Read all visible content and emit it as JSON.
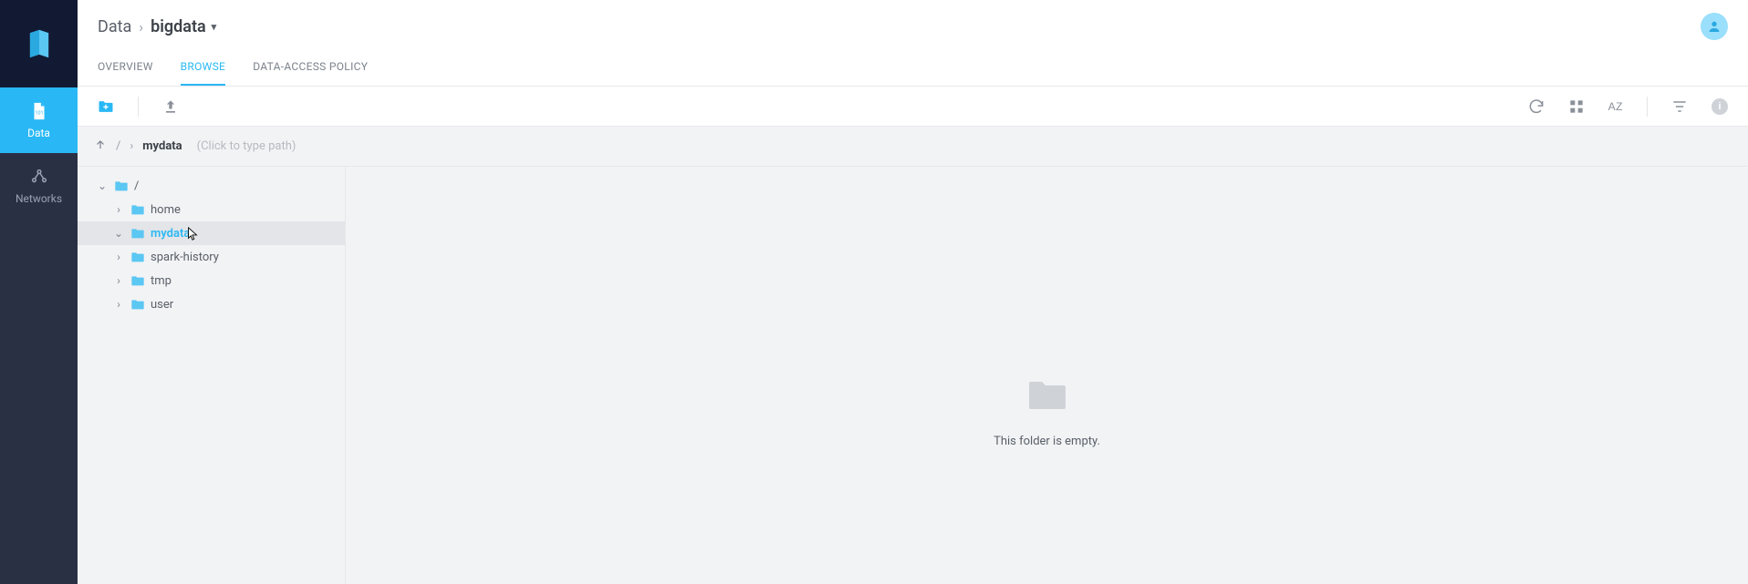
{
  "rail": {
    "items": [
      {
        "label": "Data",
        "active": true
      },
      {
        "label": "Networks",
        "active": false
      }
    ]
  },
  "breadcrumb": {
    "root": "Data",
    "current": "bigdata"
  },
  "tabs": [
    {
      "label": "OVERVIEW",
      "active": false
    },
    {
      "label": "BROWSE",
      "active": true
    },
    {
      "label": "DATA-ACCESS POLICY",
      "active": false
    }
  ],
  "toolbar": {
    "sort_label": "AZ",
    "info_glyph": "i"
  },
  "pathbar": {
    "slash1": "/",
    "chevron": "›",
    "current": "mydata",
    "placeholder": "(Click to type path)"
  },
  "tree": {
    "root_label": "/",
    "items": [
      {
        "label": "home",
        "selected": false
      },
      {
        "label": "mydata",
        "selected": true
      },
      {
        "label": "spark-history",
        "selected": false
      },
      {
        "label": "tmp",
        "selected": false
      },
      {
        "label": "user",
        "selected": false
      }
    ]
  },
  "empty": {
    "message": "This folder is empty."
  }
}
